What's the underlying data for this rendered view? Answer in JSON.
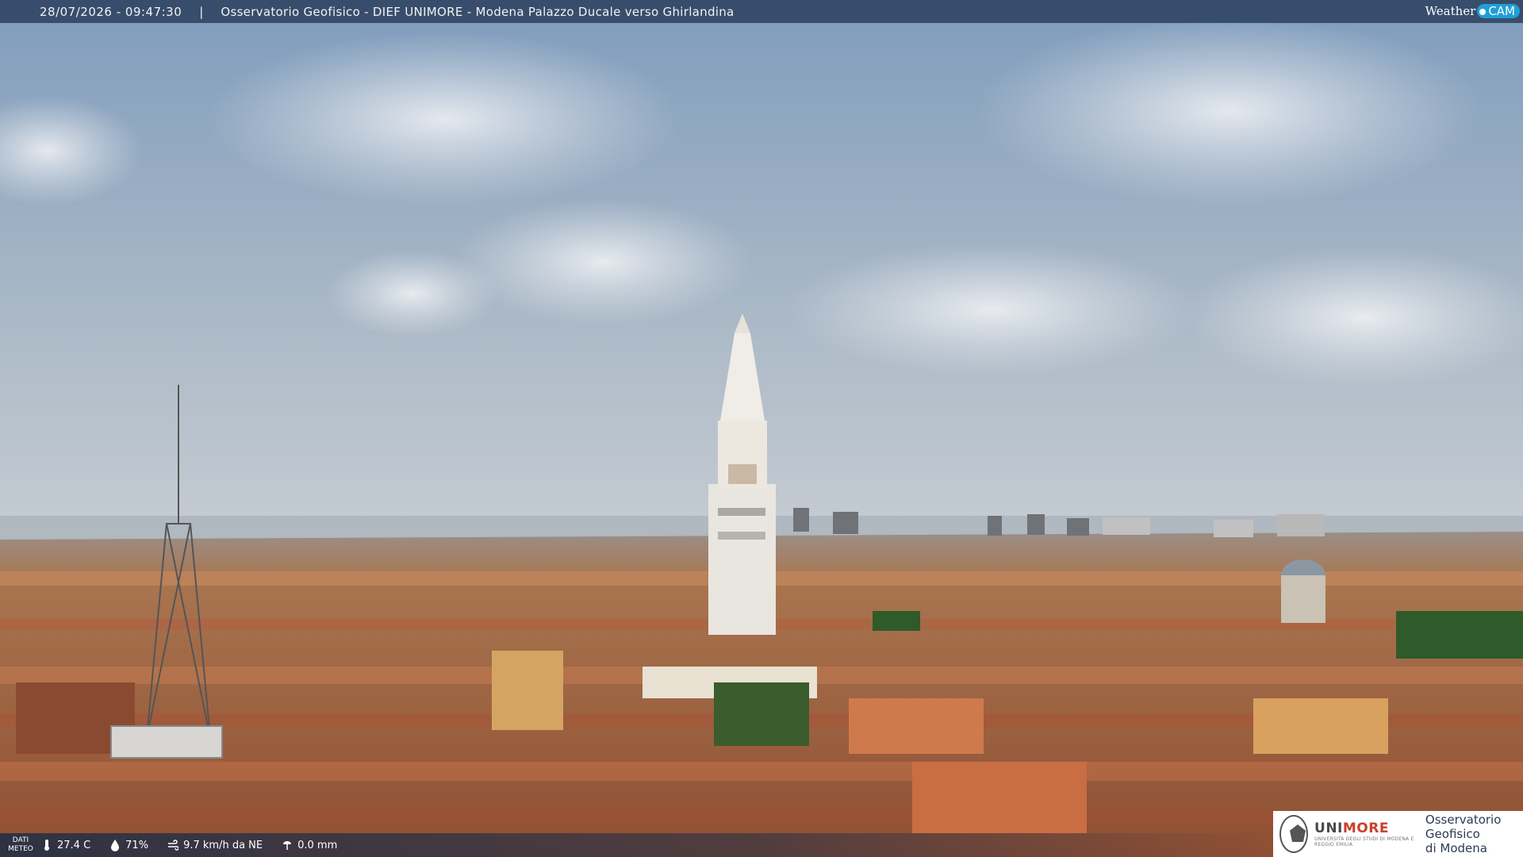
{
  "header": {
    "datetime": "28/07/2026 - 09:47:30",
    "separator": "|",
    "title": "Osservatorio Geofisico - DIEF UNIMORE - Modena Palazzo Ducale verso Ghirlandina"
  },
  "logo": {
    "weather": "Weather",
    "cam": "CAM"
  },
  "weather_bar": {
    "label_line1": "DATI",
    "label_line2": "METEO",
    "temperature": "27.4 C",
    "humidity": "71%",
    "wind": "9.7 km/h da NE",
    "rain": "0.0 mm"
  },
  "footer_logo": {
    "uni": "UNI",
    "more": "MORE",
    "sub": "UNIVERSITÀ DEGLI STUDI DI MODENA E REGGIO EMILIA",
    "observatory_line1": "Osservatorio Geofisico",
    "observatory_line2": "di Modena"
  },
  "colors": {
    "sky_top": "#7f9cbd",
    "sky_bottom": "#c8d0d8",
    "roofs": "#b56a45",
    "tower": "#e8e4dc",
    "accent": "#1f9fd6"
  }
}
